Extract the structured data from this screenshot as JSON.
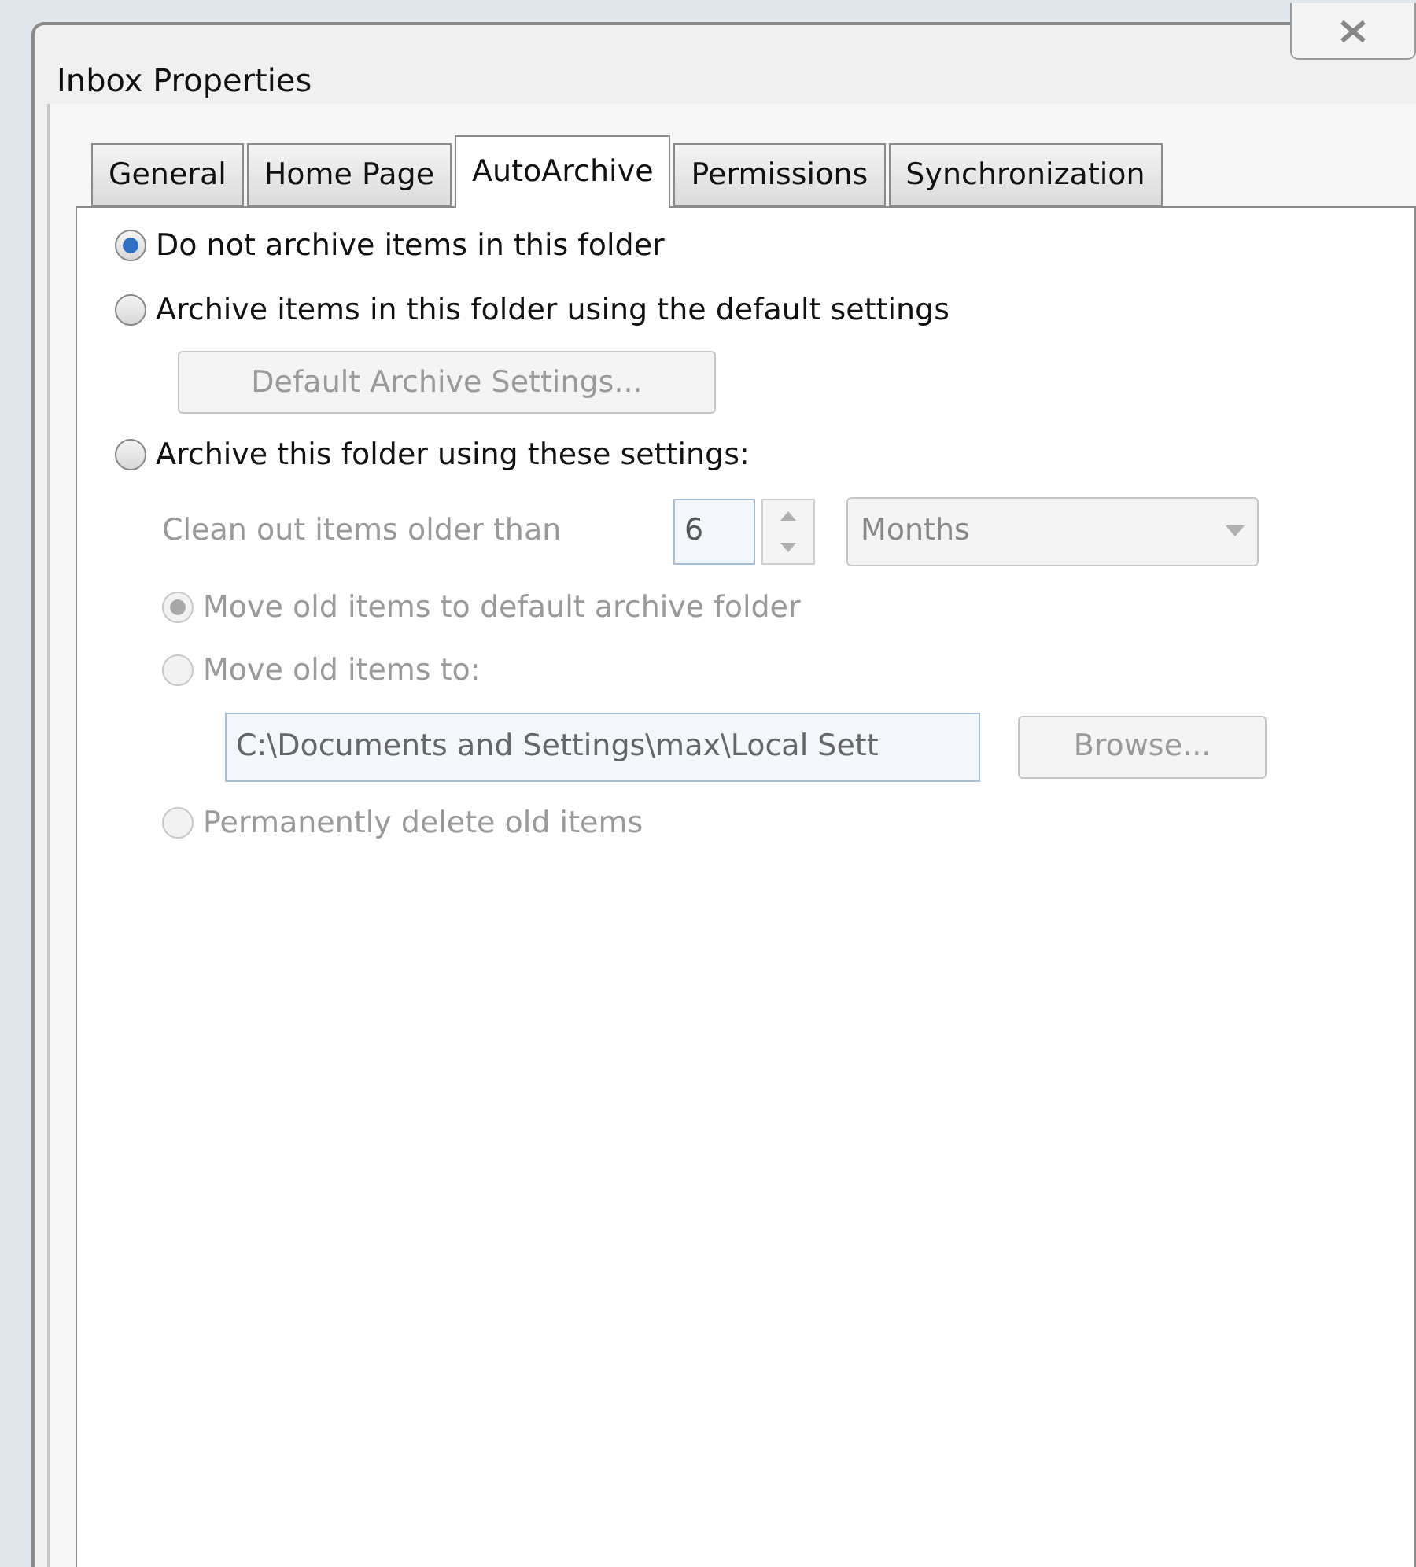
{
  "window": {
    "title": "Inbox Properties"
  },
  "tabs": [
    {
      "label": "General",
      "selected": false
    },
    {
      "label": "Home Page",
      "selected": false
    },
    {
      "label": "AutoArchive",
      "selected": true
    },
    {
      "label": "Permissions",
      "selected": false
    },
    {
      "label": "Synchronization",
      "selected": false
    }
  ],
  "archive_modes": [
    {
      "label": "Do not archive items in this folder",
      "selected": true,
      "disabled": false
    },
    {
      "label": "Archive items in this folder using the default settings",
      "selected": false,
      "disabled": false
    },
    {
      "label": "Archive this folder using these settings:",
      "selected": false,
      "disabled": false
    }
  ],
  "default_settings_button": {
    "label": "Default Archive Settings...",
    "disabled": true
  },
  "clean_out": {
    "label": "Clean out items older than",
    "value": "6",
    "unit": "Months",
    "disabled": true
  },
  "old_item_actions": [
    {
      "label": "Move old items to default archive folder",
      "selected": true,
      "disabled": true
    },
    {
      "label": "Move old items to:",
      "selected": false,
      "disabled": true
    },
    {
      "label": "Permanently delete old items",
      "selected": false,
      "disabled": true
    }
  ],
  "archive_path": {
    "value": "C:\\Documents and Settings\\max\\Local Sett",
    "disabled": true
  },
  "browse_button": {
    "label": "Browse...",
    "disabled": true
  }
}
